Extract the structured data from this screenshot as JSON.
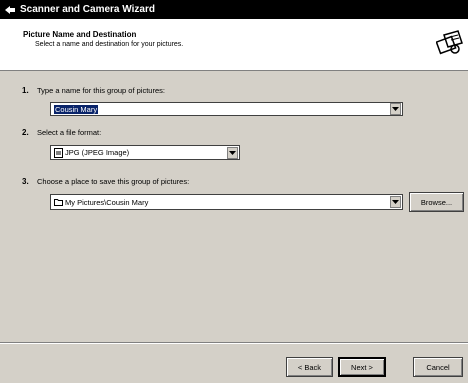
{
  "window": {
    "title": "Scanner and Camera Wizard"
  },
  "header": {
    "title": "Picture Name and Destination",
    "subtitle": "Select a name and destination for your pictures."
  },
  "steps": [
    {
      "number": "1.",
      "label": "Type a name for this group of pictures:",
      "value": "Cousin Mary"
    },
    {
      "number": "2.",
      "label": "Select a file format:",
      "value": "JPG (JPEG Image)"
    },
    {
      "number": "3.",
      "label": "Choose a place to save this group of pictures:",
      "value": "My Pictures\\Cousin Mary"
    }
  ],
  "buttons": {
    "browse": "Browse...",
    "back": "< Back",
    "next": "Next >",
    "cancel": "Cancel"
  },
  "icons": {
    "title": "wizard-icon",
    "header": "scanner-camera-icon",
    "format": "image-file-icon",
    "folder": "folder-icon",
    "dropdown": "chevron-down-icon"
  }
}
